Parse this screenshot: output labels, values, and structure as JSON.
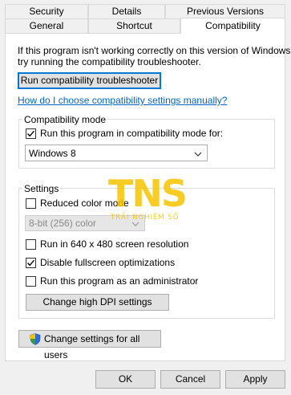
{
  "tabs_row1": [
    {
      "label": "Security"
    },
    {
      "label": "Details"
    },
    {
      "label": "Previous Versions"
    }
  ],
  "tabs_row2": [
    {
      "label": "General"
    },
    {
      "label": "Shortcut"
    },
    {
      "label": "Compatibility",
      "active": true
    }
  ],
  "intro": {
    "line1": "If this program isn't working correctly on this version of Windows,",
    "line2": "try running the compatibility troubleshooter."
  },
  "troubleshooter_button": "Run compatibility troubleshooter",
  "manual_link": "How do I choose compatibility settings manually?",
  "compat_mode": {
    "title": "Compatibility mode",
    "checkbox_label": "Run this program in compatibility mode for:",
    "checked": true,
    "selected_os": "Windows 8"
  },
  "settings": {
    "title": "Settings",
    "reduced_color_label": "Reduced color mode",
    "reduced_color_checked": false,
    "color_depth": "8-bit (256) color",
    "res_640_label": "Run in 640 x 480 screen resolution",
    "res_640_checked": false,
    "fullscreen_opt_label": "Disable fullscreen optimizations",
    "fullscreen_opt_checked": true,
    "admin_label": "Run this program as an administrator",
    "admin_checked": false,
    "high_dpi_button": "Change high DPI settings"
  },
  "all_users_button": "Change settings for all users",
  "footer": {
    "ok": "OK",
    "cancel": "Cancel",
    "apply": "Apply"
  },
  "watermark": {
    "logo": "TNS",
    "tagline": "TRẢI NGHIỆM SỐ"
  },
  "colors": {
    "link": "#0066cc",
    "focus": "#0078d7",
    "watermark": "#f5c400"
  }
}
